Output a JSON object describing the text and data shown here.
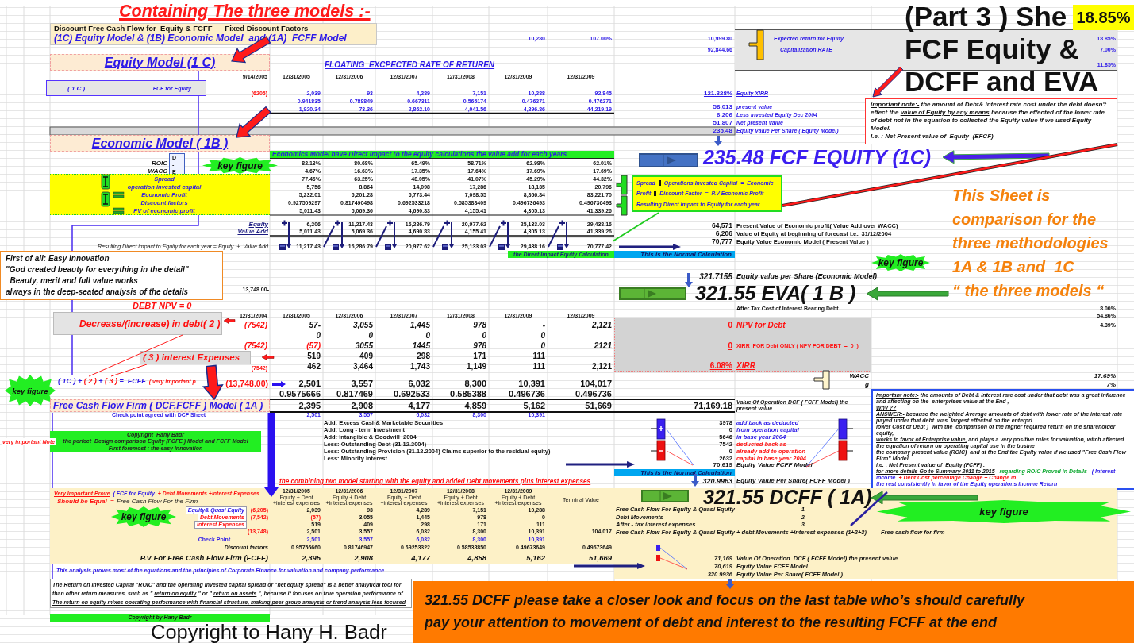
{
  "banner": {
    "text": "Containing The three models :-"
  },
  "header": {
    "line_1": "Discount Free Cash Flow for  Equity & FCFF      Fixed Discount Factors",
    "line_2": "(1C) Equity Model & (1B) Economic Model  and (1A)  FCFF Model"
  },
  "header_figures": [
    "10,280",
    "107.00%",
    "10,999.80",
    "92,844.66"
  ],
  "rates_panel": [
    {
      "label": "Expected return for Equity",
      "value": "18.85%"
    },
    {
      "label": "Capitalization RATE",
      "value": "7.00%"
    },
    {
      "value": "11.85%"
    }
  ],
  "sheet_title": {
    "lines": [
      "(Part 3 ) She",
      "FCF Equity &",
      "DCFF and EVA"
    ],
    "badge": "18.85%"
  },
  "equity_note": {
    "segments": [
      {
        "text": "important note:-",
        "kind": "underline"
      },
      {
        "text": " the amount of Debt& interest rate cost under the debt doesn't effect the ",
        "kind": "plain"
      },
      {
        "text": "value of Equity by any means",
        "kind": "underline"
      },
      {
        "text": " because the effected of the lower rate of debt not in the equation to collected the Equity value if we used Equity Model.",
        "kind": "plain"
      }
    ],
    "closing": "I.e. : Net Present value of  Equity  (EFCF)"
  },
  "equity_model": {
    "title": "Equity Model (1 C)",
    "subtitle": "FLOATING  EXCPECTED RATE OF RETUREN",
    "dates": [
      "9/14/2005",
      "12/31/2005",
      "12/31/2006",
      "12/31/2007",
      "12/31/2008",
      "12/31/2009",
      "12/31/2009"
    ],
    "label_box": {
      "code": "( 1 C )",
      "label": "FCF for Equity"
    },
    "cash_flows": [
      "(6205)",
      "2,039",
      "93",
      "4,289",
      "7,151",
      "10,288",
      "92,845"
    ],
    "discount_factors": [
      "0.941835",
      "0.788849",
      "0.667311",
      "0.565174",
      "0.476271",
      "0.476271"
    ],
    "present_values": [
      "1,920.34",
      "73.36",
      "2,862.10",
      "4,041.56",
      "4,896.86",
      "44,219.19"
    ],
    "summary": [
      {
        "figure": "121.828%",
        "caption": "Equity XIRR"
      },
      {
        "figure": "58,013",
        "caption": "present value"
      },
      {
        "figure": "6,206",
        "caption": "Less invested Equity Dec 2004"
      },
      {
        "figure": "51,807",
        "caption": "Net present Value"
      },
      {
        "figure": "235.48",
        "caption": "Equity Value Per Share ( Equity Model)"
      }
    ]
  },
  "fcf_equity_result": "235.48 FCF EQUITY (1C)",
  "economic_model": {
    "title": "Economic Model ( 1B )",
    "banner": "Economics Model have Direct impact to the equity calculations the value add for each years",
    "ratio_labels": [
      "ROIC",
      "WACC"
    ],
    "difference_marks": [
      "D",
      "-",
      "E"
    ],
    "key_figure": "key figure",
    "labels": [
      "Spread",
      "operation invested capital",
      "Economic Profit",
      "Discount factors",
      "PV of economic profit"
    ],
    "rows": [
      [
        "82.13%",
        "80.68%",
        "65.49%",
        "58.71%",
        "62.98%",
        "62.01%"
      ],
      [
        "4.67%",
        "16.63%",
        "17.35%",
        "17.64%",
        "17.69%",
        "17.69%"
      ],
      [
        "77.46%",
        "63.25%",
        "48.05%",
        "41.07%",
        "45.29%",
        "44.32%"
      ],
      [
        "5,756",
        "8,864",
        "14,098",
        "17,286",
        "18,135",
        "20,796"
      ],
      [
        "5,232.01",
        "6,201.28",
        "6,773.44",
        "7,098.55",
        "8,866.84",
        "83,221.70"
      ],
      [
        "0.927509297",
        "0.817490498",
        "0.692533218",
        "0.585388409",
        "0.496736493",
        "0.496736493"
      ],
      [
        "5,011.43",
        "5,069.36",
        "4,690.83",
        "4,155.41",
        "4,305.13",
        "41,339.26"
      ]
    ],
    "callout": {
      "rows": [
        {
          "term": "Spread",
          "text": "Operations Invested Capital  =  Economic"
        },
        {
          "term": "Profit",
          "text": "Discount Factor  =  P.V Economic Profit"
        }
      ],
      "footer": "Resulting Direct impact to Equity for each year"
    },
    "equity_label": "Equity",
    "value_add_label": "Value Add",
    "equity_row": [
      "6,206",
      "11,217.43",
      "16,286.79",
      "20,977.62",
      "25,133.03",
      "29,438.16"
    ],
    "value_add_row": [
      "5,011.43",
      "5,069.36",
      "4,690.83",
      "4,155.41",
      "4,305.13",
      "41,339.26"
    ],
    "result_label": "Resulting Direct impact to Equity for each year = Equity  +  Value Add",
    "result_row": [
      "11,217.43",
      "16,286.79",
      "20,977.62",
      "25,133.03",
      "29,438.16",
      "70,777.42"
    ],
    "result_tag": "the Direct Impact Equity Calculation",
    "summary": [
      {
        "figure": "64,571",
        "caption": "Present Value of Economic profit( Value Add over WACC)"
      },
      {
        "figure": "6,206",
        "caption": "Value of Equity at beginning of forecast i.e.. 31/12/2004"
      },
      {
        "figure": "70,777",
        "caption": "Equity Value Economic Model ( Present Value )"
      }
    ],
    "normal_calculation": "This is the Normal Calculation",
    "per_share": {
      "value": "321.7155",
      "label": "Equity value per Share (Economic Model)"
    }
  },
  "eva_key_figure": "key figure",
  "eva_result": "321.55 EVA( 1 B )",
  "comparison_note": [
    "This Sheet is",
    "comparison for the",
    "three methodologies",
    "1A & 1B and  1C",
    "“ the three models “"
  ],
  "quote": [
    "First of all: Easy Innovation",
    "\"God created beauty for everything in the detail\"",
    "  Beauty, merit and full value works",
    "always in the deep-seated analysis of the details"
  ],
  "debt": {
    "npv_label": "DEBT NPV = 0",
    "total_before": "13,748.00-",
    "dates": [
      "12/31/2004",
      "12/31/2005",
      "12/31/2006",
      "12/31/2007",
      "12/31/2008",
      "12/31/2009",
      "12/31/2009"
    ],
    "decrease_label": "Decrease/(increase) in debt",
    "decrease_code": "( 2 )",
    "debt_row": [
      "(7542)",
      "57-",
      "3,055",
      "1,445",
      "978",
      "-",
      "2,121"
    ],
    "zero_row": [
      "0",
      "0",
      "0",
      "0",
      "0"
    ],
    "movement_row": [
      "(7542)",
      "(57)",
      "3055",
      "1445",
      "978",
      "0",
      "2121"
    ],
    "interest_label": "( 3 ) interest Expenses",
    "interest_row": [
      "519",
      "409",
      "298",
      "171",
      "111"
    ],
    "total_row": [
      "(7542)",
      "462",
      "3,464",
      "1,743",
      "1,149",
      "111",
      "2,121"
    ],
    "results": [
      {
        "value": "0",
        "label": "NPV for Debt"
      },
      {
        "value": "0",
        "label": "XIRR  FOR Debt ONLY ( NPV FOR DEBT  =  0  )"
      },
      {
        "value": "6.08%",
        "label": "XIRR"
      }
    ],
    "tax_label": "After Tax Cost of Interest Bearing Debt",
    "rates": [
      "8.00%",
      "54.86%",
      "4.39%"
    ],
    "wacc": {
      "label": "WACC",
      "value": "17.69%"
    },
    "growth": {
      "label": "g",
      "value": "7%"
    }
  },
  "fcff": {
    "formula": [
      {
        "text": "( 1C )",
        "kind": "equity"
      },
      {
        "text": " + ",
        "kind": "operator"
      },
      {
        "text": "( 2 )",
        "kind": "debt"
      },
      {
        "text": " + ",
        "kind": "operator"
      },
      {
        "text": "( 3 )",
        "kind": "interest"
      },
      {
        "text": " =  ",
        "kind": "operator"
      },
      {
        "text": "FCFF",
        "kind": "result"
      },
      {
        "text": "  ( very important p",
        "kind": "remark"
      }
    ],
    "formula_total": "(13,748.00)",
    "key_figure": "key figure",
    "fcff_row": [
      "2,501",
      "3,557",
      "6,032",
      "8,300",
      "10,391",
      "104,017"
    ],
    "factor_row": [
      "0.9575666",
      "0.817469",
      "0.692533",
      "0.585388",
      "0.496736",
      "0.496736"
    ],
    "title": "Free Cash Flow Firm ( DCF.FCFF ) Model ( 1A )",
    "pv_row": [
      "2,395",
      "2,908",
      "4,177",
      "4,859",
      "5,162",
      "51,669"
    ],
    "pv_total": "71,169.18",
    "pv_total_label": "Value Of Operation  DCF ( FCFF Model) the present value",
    "check_label": "Check point agreed with DCF Sheet",
    "check_row": [
      "2,501",
      "3,557",
      "6,032",
      "8,300",
      "10,391"
    ],
    "adjustments": [
      {
        "kind": "add",
        "label": "Add: Excess Cash& Marketable Securities",
        "value": "3978",
        "note": "add back as deducted"
      },
      {
        "kind": "add",
        "label": "Add: Long - term Investment",
        "value": "0",
        "note": "from operation capital"
      },
      {
        "kind": "add",
        "label": "Add: Intangible & Goodwill  2004",
        "value": "5646",
        "note": "in base year 2004"
      },
      {
        "kind": "less",
        "label": "Less: Outstanding Debt (31.12.2004)",
        "value": "7542",
        "note": "deducted back as"
      },
      {
        "kind": "less",
        "label": "Less: Outstanding Provision (31.12.2004) Claims superior to the residual equity)",
        "value": "0",
        "note": "already add to operation"
      },
      {
        "kind": "less",
        "label": "Less: Minority interest",
        "value": "2632",
        "note": "capital in base year 2004"
      }
    ],
    "equity_value": {
      "value": "70,619",
      "label": "Equity Value FCFF Model"
    },
    "normal_calculation": "This is the Normal Calculation",
    "per_share": {
      "value": "320.9963",
      "label": "Equity Value Per Share( FCFF Model )"
    },
    "combining_note": "the combining two model starting with the equity and added Debt Movements plus interest expenses"
  },
  "copyright_block": [
    "Copyright  Hany Badr",
    "the perfect  Design comparison Equity (FCFE ) Model and FCFF Model",
    "First foremost : the easy innovation"
  ],
  "side_note": "very important Note",
  "enterprise_note": [
    {
      "segments": [
        {
          "text": "important note:-",
          "kind": "underline"
        },
        {
          "text": " the amounts of Debt & interest rate cost under that debt was a great influence and affecting on the  enterprises value at the End ,",
          "kind": "plain"
        }
      ]
    },
    {
      "segments": [
        {
          "text": "Why ??",
          "kind": "underline"
        }
      ]
    },
    {
      "segments": [
        {
          "text": "ANSWER:-",
          "kind": "underline"
        },
        {
          "text": " because the weighted Average amounts of debt with lower rate of the interest rate payed under that debt ,was  largest effected on the enterpri",
          "kind": "plain"
        }
      ]
    },
    {
      "segments": [
        {
          "text": "lower Cost of Debt )  with the  comparison of the higher required return on the shareholder equity,",
          "kind": "plain"
        }
      ]
    },
    {
      "segments": [
        {
          "text": "works in favor of Enterprise value,",
          "kind": "underline"
        },
        {
          "text": " and plays a very positive rules for valuation, witch affected  the equation of return on operating capital use in the busine",
          "kind": "plain"
        }
      ]
    },
    {
      "segments": [
        {
          "text": "the company present value (ROIC)  and at the End the Equity value if we used \"Free Cash Flow Firm\" Model.",
          "kind": "plain"
        }
      ]
    },
    {
      "segments": [
        {
          "text": "i.e. : Net Present value of  Equity (FCFF) .",
          "kind": "plain"
        }
      ]
    },
    {
      "segments": [
        {
          "text": "for more details Go to Summary 2011 to 2015",
          "kind": "underline"
        },
        {
          "text": "   regarding ROIC Proved in Details  ",
          "kind": "green"
        },
        {
          "text": " ( Interest Income ",
          "kind": "blue"
        },
        {
          "text": " + Debt Cost percentage Change + Change in",
          "kind": "red"
        }
      ]
    },
    {
      "segments": [
        {
          "text": "the rest",
          "kind": "blue-underline"
        },
        {
          "text": " consistently in favor of the Equity operations Income Return",
          "kind": "blue"
        }
      ]
    }
  ],
  "prove_table": {
    "heading": [
      {
        "text": "Very Important Prove",
        "kind": "red-underline"
      },
      {
        "text": "  ( FCF for Equity ",
        "kind": "blue"
      },
      {
        "text": " + Debt Movements +Interest Expenses",
        "kind": "red"
      }
    ],
    "equal_label": "Should be Equal  =",
    "equal_target": "Free Cash Flow For the Firm",
    "dates": [
      "12/31/2005",
      "12/31/2006",
      "12/31/2007",
      "12/31/2008",
      "12/31/2009"
    ],
    "captions": [
      "Equity + Debt +interest expenses",
      "Equity + Debt +interest expenses",
      "Equity + Debt +interest expenses",
      "Equity + Debt +interest expenses",
      "Equity + Debt +interest expenses"
    ],
    "terminal_label": "Terminal Value",
    "rows": [
      {
        "kind": "equity",
        "lead": "(6,205)",
        "label": "Equity& Quasi Equity",
        "values": [
          "2,039",
          "93",
          "4,289",
          "7,151",
          "10,288"
        ]
      },
      {
        "kind": "debt",
        "lead": "(7,542)",
        "label": "Debt Movements",
        "values": [
          "(57)",
          "3,055",
          "1,445",
          "978",
          "0"
        ]
      },
      {
        "kind": "interest",
        "label": "Interest Expenses",
        "values": [
          "519",
          "409",
          "298",
          "171",
          "111"
        ]
      }
    ],
    "total": {
      "lead": "(13,748)",
      "values": [
        "2,501",
        "3,557",
        "6,032",
        "8,300",
        "10,391"
      ],
      "terminal": "104,017"
    },
    "check": {
      "label": "Check Point",
      "values": [
        "2,501",
        "3,557",
        "6,032",
        "8,300",
        "10,391"
      ]
    },
    "factors": {
      "label": "Discount factors",
      "values": [
        "0.95756660",
        "0.81746947",
        "0.69253322",
        "0.58538850",
        "0.49673649",
        "0.49673649"
      ]
    },
    "pv": {
      "label": "P.V For Free Cash Flow Firm (FCFF)",
      "values": [
        "2,395",
        "2,908",
        "4,177",
        "4,858",
        "5,162",
        "51,669"
      ]
    },
    "legend": [
      {
        "text": "Free Cash Flow For Equity & Quasi Equity",
        "number": "1"
      },
      {
        "text": "Debt Movements",
        "number": "2"
      },
      {
        "text": "After - tax interest expenses",
        "number": "3"
      },
      {
        "text": "Free Cash Flow For Equity & Quasi Equity + debt Movements +interest expenses (1+2+3)"
      }
    ],
    "firm_label": "Free cash flow for firm",
    "key_figure_left": "key figure",
    "key_figure_right": "key figure",
    "summary": [
      {
        "figure": "71,169",
        "caption": "Value Of Operation  DCF ( FCFF Model) the present value"
      },
      {
        "figure": "70,619",
        "caption": "Equity Value FCFF Model"
      },
      {
        "figure": "320.9936",
        "caption": "Equity Value Per Share( FCFF Model )"
      }
    ]
  },
  "dcff_result": "321.55 DCFF ( 1A)",
  "analysis_note": "This analysis proves most of the equations and the principles of Corporate Finance for valuation and company performance",
  "roic_note": [
    {
      "segments": [
        {
          "text": "The Return on Invested Capital \"ROIC\" and the operating invested capital spread or \"net equity spread\" is a better analytical tool for",
          "kind": "plain"
        }
      ]
    },
    {
      "segments": [
        {
          "text": "than other return measures, such as \" ",
          "kind": "plain"
        },
        {
          "text": "return on equity",
          "kind": "underline"
        },
        {
          "text": " \" or \" ",
          "kind": "plain"
        },
        {
          "text": "return on assets",
          "kind": "underline"
        },
        {
          "text": " \", because it focuses on true operation performance of",
          "kind": "plain"
        }
      ]
    },
    {
      "segments": [
        {
          "text": "The return on equity mixes operating performance with financial structure, making peer group analysis or trend analysis less focused",
          "kind": "underline"
        }
      ]
    }
  ],
  "footer_copyright": "Copyright by Hany Badr",
  "copyright_caption": "Copyright to Hany H. Badr",
  "closing_note": [
    "321.55 DCFF please take a closer look and focus on the last table who’s should carefully",
    "pay your attention to movement of debt and interest to the resulting FCFF at the end"
  ]
}
